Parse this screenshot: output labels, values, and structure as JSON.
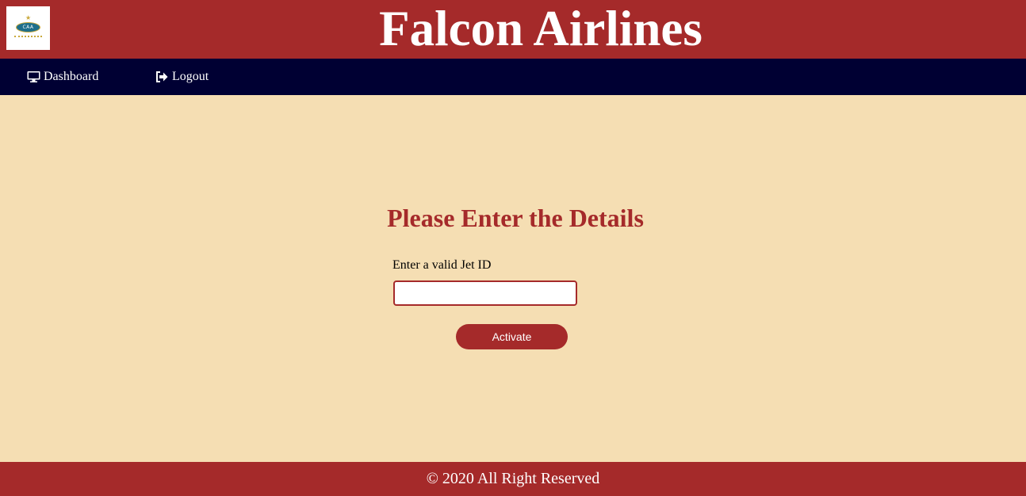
{
  "header": {
    "title": "Falcon Airlines",
    "logo_text": "CAA",
    "background_color": "#a52a2a"
  },
  "nav": {
    "items": [
      {
        "label": "Dashboard",
        "icon": "desktop-icon"
      },
      {
        "label": "Logout",
        "icon": "sign-out-icon"
      }
    ],
    "background_color": "#000033"
  },
  "main": {
    "heading": "Please Enter the Details",
    "jet_id_label": "Enter a valid Jet ID",
    "jet_id_value": "",
    "jet_id_placeholder": "",
    "activate_label": "Activate",
    "background_color": "#f5deb3",
    "accent_color": "#a52a2a"
  },
  "footer": {
    "text": "© 2020 All Right Reserved"
  }
}
